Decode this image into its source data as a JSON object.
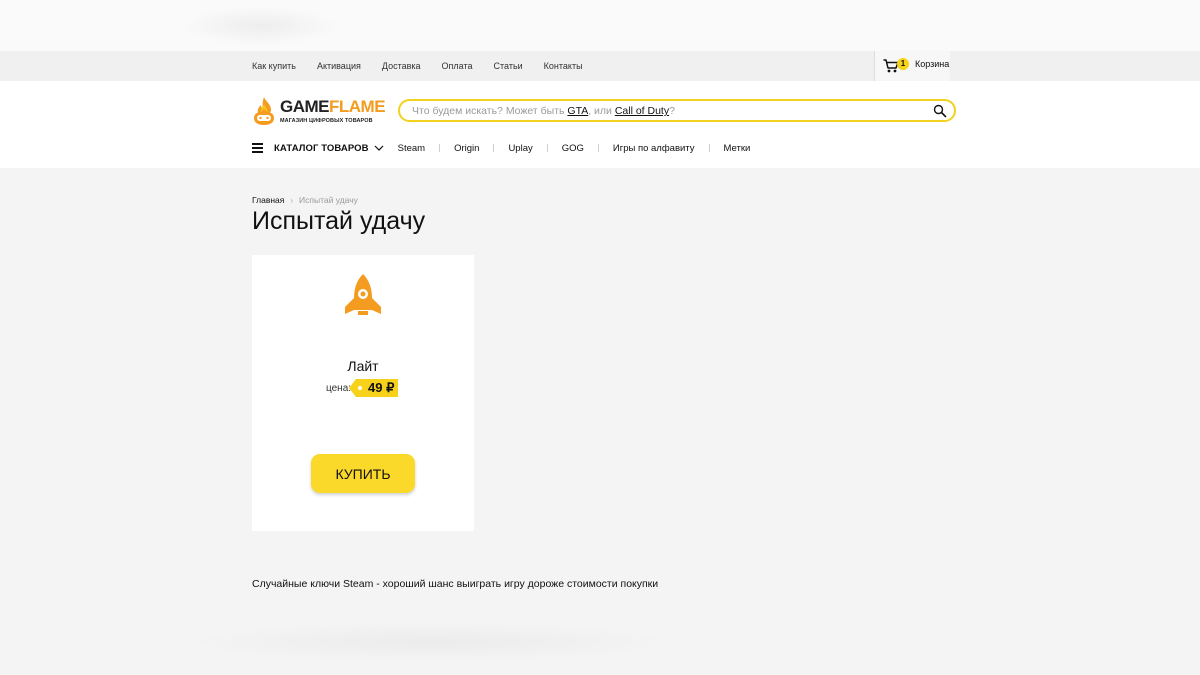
{
  "topnav": {
    "links": [
      "Как купить",
      "Активация",
      "Доставка",
      "Оплата",
      "Статьи",
      "Контакты"
    ],
    "cart_count": "1",
    "cart_label": "Корзина"
  },
  "header": {
    "logo_title_a": "GAME",
    "logo_title_b": "FLAME",
    "logo_subtitle": "МАГАЗИН ЦИФРОВЫХ ТОВАРОВ",
    "search": {
      "prefix": "Что будем искать? Может быть ",
      "hint1": "GTA",
      "middle": ", или ",
      "hint2": "Call of Duty",
      "suffix": "?"
    }
  },
  "catnav": {
    "catalog_label": "КАТАЛОГ ТОВАРОВ",
    "platforms": [
      "Steam",
      "Origin",
      "Uplay",
      "GOG",
      "Игры по алфавиту",
      "Метки"
    ]
  },
  "breadcrumb": {
    "home": "Главная",
    "current": "Испытай удачу"
  },
  "page_title": "Испытай удачу",
  "card": {
    "name": "Лайт",
    "price_label": "цена:",
    "price": "49 ₽",
    "buy_label": "КУПИТЬ",
    "icon": "rocket-icon"
  },
  "description": "Случайные ключи Steam - хороший шанс выиграть игру дороже стоимости покупки",
  "colors": {
    "accent_yellow": "#fbd92b",
    "rocket_orange": "#f39c1f",
    "search_border": "#f1d21e"
  }
}
